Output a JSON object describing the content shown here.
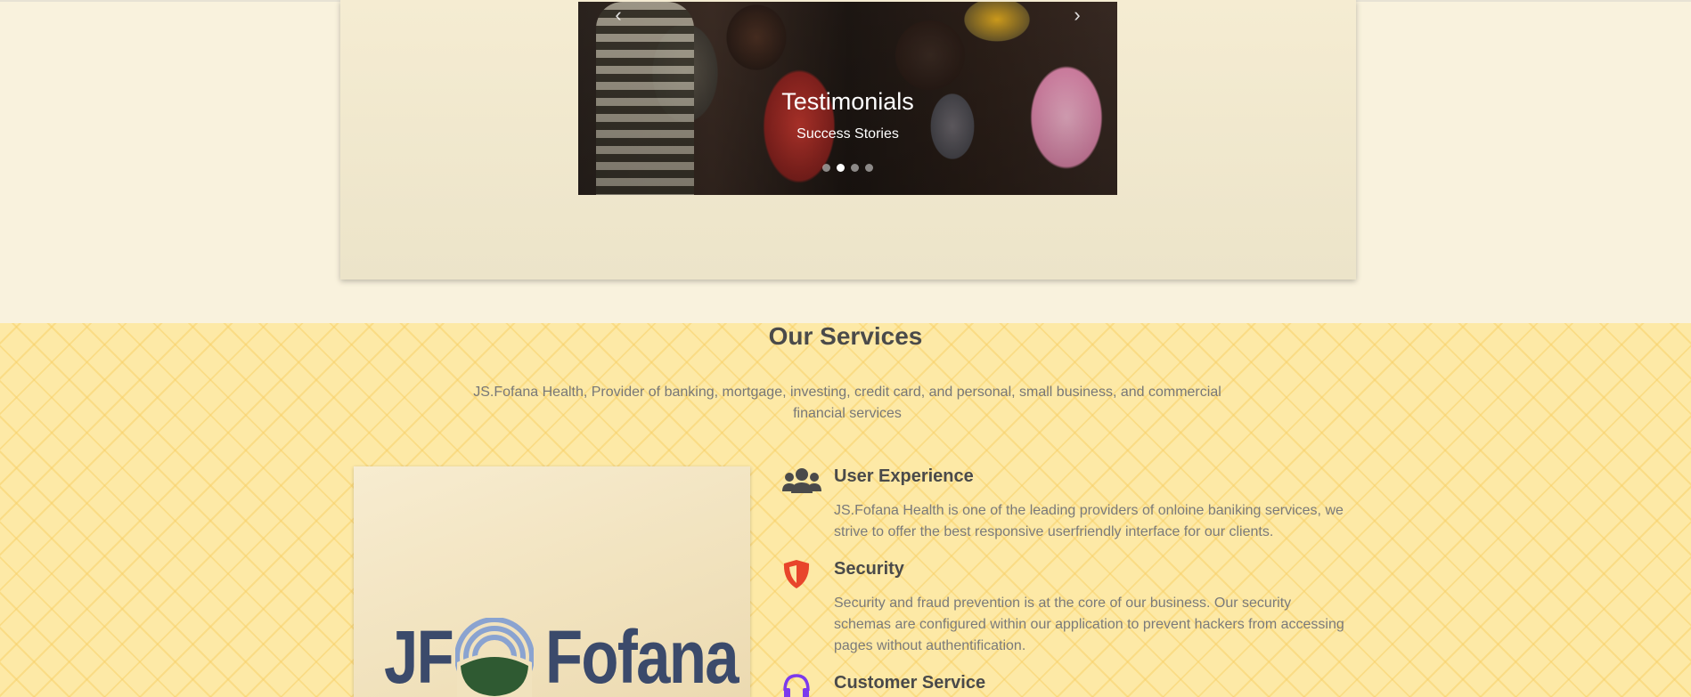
{
  "carousel": {
    "title": "Testimonials",
    "subtitle": "Success Stories",
    "prev_icon": "chevron-left-icon",
    "next_icon": "chevron-right-icon",
    "slide_count": 4,
    "active_slide": 2
  },
  "services": {
    "title": "Our Services",
    "description": "JS.Fofana Health, Provider of banking, mortgage, investing, credit card, and personal, small business, and commercial financial services",
    "logo": {
      "left_text": "JF",
      "right_text": "Fofana"
    },
    "features": [
      {
        "icon": "users-icon",
        "icon_color": "#4a4a4a",
        "title": "User Experience",
        "text": "JS.Fofana Health is one of the leading providers of onloine baniking services, we strive to offer the best responsive userfriendly interface for our clients."
      },
      {
        "icon": "shield-icon",
        "icon_color": "#e8452b",
        "title": "Security",
        "text": "Security and fraud prevention is at the core of our business. Our security schemas are configured within our application to prevent hackers from accessing pages without authentification."
      },
      {
        "icon": "headset-icon",
        "icon_color": "#7c3aed",
        "title": "Customer Service",
        "text": ""
      }
    ]
  }
}
